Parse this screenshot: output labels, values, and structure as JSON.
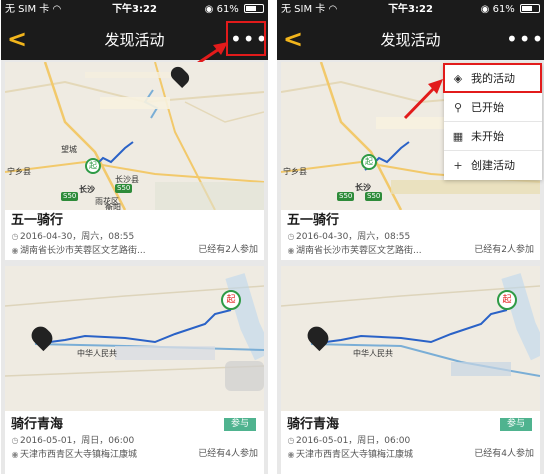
{
  "status": {
    "carrier": "无 SIM 卡",
    "time": "下午3:22",
    "battery": "61%",
    "battery_level": 0.61
  },
  "nav": {
    "title": "发现活动",
    "back_icon": "chevron-left-icon",
    "more_label": "•••"
  },
  "map1": {
    "city": "长沙",
    "city2": "衡阳",
    "route": "S50",
    "route2": "S50",
    "place1": "望城",
    "place2": "宁乡县",
    "place3": "长沙县",
    "place4": "雨花区",
    "start_marker": "起"
  },
  "map2": {
    "place": "中华人民共",
    "start_marker": "起"
  },
  "events": [
    {
      "title": "五一骑行",
      "date": "2016-04-30，周六，08:55",
      "location": "湖南省长沙市芙蓉区文艺路街...",
      "count": "已经有2人参加",
      "badge": ""
    },
    {
      "title": "骑行青海",
      "date": "2016-05-01，周日，06:00",
      "location": "天津市西青区大寺镇梅江康城",
      "count": "已经有4人参加",
      "badge": "参与"
    }
  ],
  "menu": {
    "items": [
      {
        "label": "我的活动",
        "icon": "layers-icon"
      },
      {
        "label": "已开始",
        "icon": "bicycle-icon"
      },
      {
        "label": "未开始",
        "icon": "calendar-icon"
      },
      {
        "label": "创建活动",
        "icon": "plus-icon"
      }
    ]
  },
  "colors": {
    "accent": "#f2b51c",
    "highlight": "#e21b1b",
    "badge": "#4fb38f",
    "bar": "#1b1b1b"
  }
}
